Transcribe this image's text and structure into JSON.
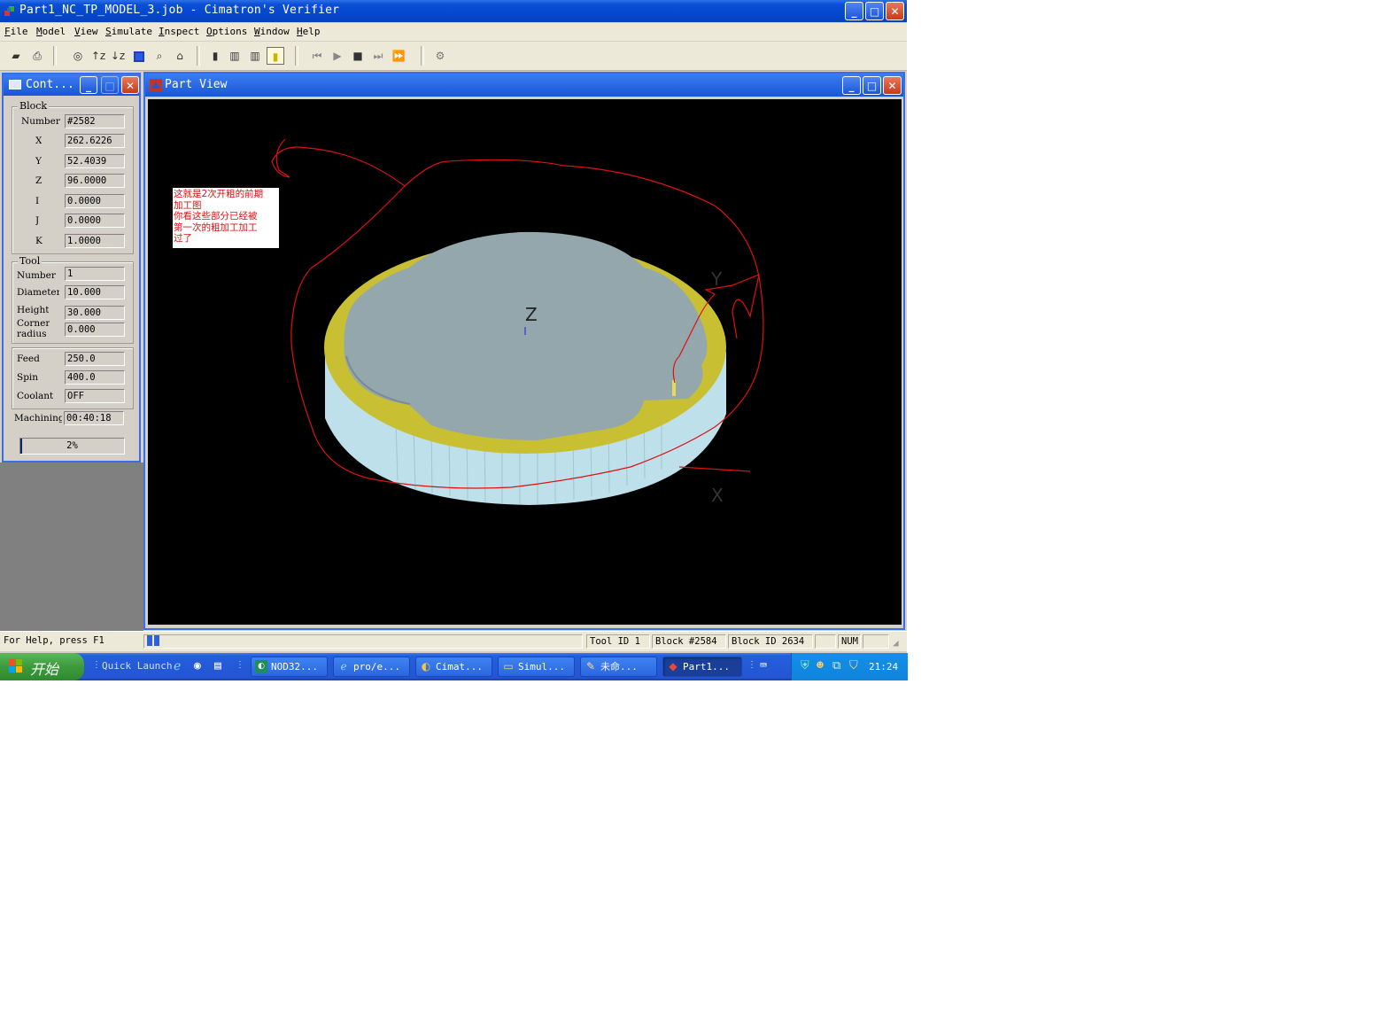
{
  "window": {
    "title": "Part1_NC_TP_MODEL_3.job - Cimatron's Verifier"
  },
  "menu": [
    "File",
    "Model",
    "View",
    "Simulate",
    "Inspect",
    "Options",
    "Window",
    "Help"
  ],
  "toolbar": {
    "items": [
      "open-icon",
      "print-icon",
      "camera-icon",
      "rotate-z-up-icon",
      "rotate-z-down-icon",
      "fit-view-icon",
      "zoom-icon",
      "pan-icon",
      "tool-holder-icon",
      "cylinder-solid-icon",
      "cylinder-wire-icon",
      "cylinder-shaded-icon",
      "rewind-icon",
      "play-icon",
      "stop-icon",
      "step-icon",
      "fast-forward-icon",
      "settings-icon"
    ]
  },
  "control_panel": {
    "title": "Cont...",
    "block": {
      "legend": "Block",
      "number_label": "Number",
      "number": "#2582",
      "x_label": "X",
      "x": "262.6226",
      "y_label": "Y",
      "y": "52.4039",
      "z_label": "Z",
      "z": "96.0000",
      "i_label": "I",
      "i": "0.0000",
      "j_label": "J",
      "j": "0.0000",
      "k_label": "K",
      "k": "1.0000"
    },
    "tool": {
      "legend": "Tool",
      "number_label": "Number",
      "number": "1",
      "diameter_label": "Diameter",
      "diameter": "10.000",
      "height_label": "Height",
      "height": "30.000",
      "corner_label_1": "Corner",
      "corner_label_2": "radius",
      "corner_radius": "0.000"
    },
    "motion": {
      "feed_label": "Feed",
      "feed": "250.0",
      "spin_label": "Spin",
      "spin": "400.0",
      "coolant_label": "Coolant",
      "coolant": "OFF"
    },
    "machining_label": "Machining",
    "machining_time": "00:40:18",
    "progress_text": "2%",
    "progress": 0.02
  },
  "part_view": {
    "title": "Part View",
    "axis_z": "Z",
    "axis_y": "Y",
    "axis_x": "X",
    "note_lines": [
      "这就是2次开粗的前期",
      "加工图",
      "你看这些部分已经被",
      "第一次的粗加工加工",
      "过了"
    ],
    "colors": {
      "top_face": "#94a7ac",
      "rim": "#c8c032",
      "side": "#bde0ea",
      "annotation": "#e01010"
    }
  },
  "status_bar": {
    "help": "For Help, press F1",
    "tool_id": "Tool ID 1",
    "block": "Block #2584",
    "block_id": "Block ID 2634",
    "num": "NUM"
  },
  "taskbar": {
    "start": "开始",
    "quick_launch": "Quick Launch",
    "tasks": [
      {
        "label": "NOD32...",
        "icon": "nod32-icon"
      },
      {
        "label": "pro/e...",
        "icon": "ie-icon"
      },
      {
        "label": "Cimat...",
        "icon": "cimatron-icon"
      },
      {
        "label": "Simul...",
        "icon": "folder-icon"
      },
      {
        "label": "未命...",
        "icon": "paint-icon"
      },
      {
        "label": "Part1...",
        "icon": "verifier-icon"
      }
    ],
    "clock": "21:24"
  }
}
